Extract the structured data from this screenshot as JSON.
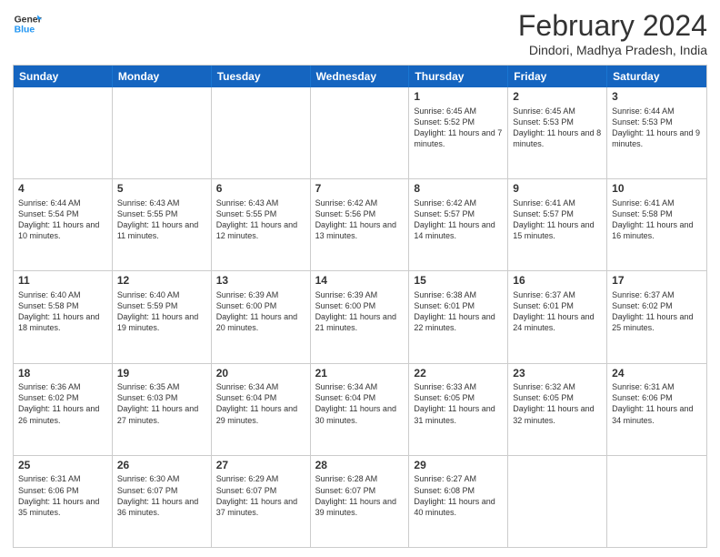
{
  "logo": {
    "line1": "General",
    "line2": "Blue"
  },
  "title": "February 2024",
  "subtitle": "Dindori, Madhya Pradesh, India",
  "days": [
    "Sunday",
    "Monday",
    "Tuesday",
    "Wednesday",
    "Thursday",
    "Friday",
    "Saturday"
  ],
  "weeks": [
    [
      {
        "day": "",
        "info": ""
      },
      {
        "day": "",
        "info": ""
      },
      {
        "day": "",
        "info": ""
      },
      {
        "day": "",
        "info": ""
      },
      {
        "day": "1",
        "info": "Sunrise: 6:45 AM\nSunset: 5:52 PM\nDaylight: 11 hours and 7 minutes."
      },
      {
        "day": "2",
        "info": "Sunrise: 6:45 AM\nSunset: 5:53 PM\nDaylight: 11 hours and 8 minutes."
      },
      {
        "day": "3",
        "info": "Sunrise: 6:44 AM\nSunset: 5:53 PM\nDaylight: 11 hours and 9 minutes."
      }
    ],
    [
      {
        "day": "4",
        "info": "Sunrise: 6:44 AM\nSunset: 5:54 PM\nDaylight: 11 hours and 10 minutes."
      },
      {
        "day": "5",
        "info": "Sunrise: 6:43 AM\nSunset: 5:55 PM\nDaylight: 11 hours and 11 minutes."
      },
      {
        "day": "6",
        "info": "Sunrise: 6:43 AM\nSunset: 5:55 PM\nDaylight: 11 hours and 12 minutes."
      },
      {
        "day": "7",
        "info": "Sunrise: 6:42 AM\nSunset: 5:56 PM\nDaylight: 11 hours and 13 minutes."
      },
      {
        "day": "8",
        "info": "Sunrise: 6:42 AM\nSunset: 5:57 PM\nDaylight: 11 hours and 14 minutes."
      },
      {
        "day": "9",
        "info": "Sunrise: 6:41 AM\nSunset: 5:57 PM\nDaylight: 11 hours and 15 minutes."
      },
      {
        "day": "10",
        "info": "Sunrise: 6:41 AM\nSunset: 5:58 PM\nDaylight: 11 hours and 16 minutes."
      }
    ],
    [
      {
        "day": "11",
        "info": "Sunrise: 6:40 AM\nSunset: 5:58 PM\nDaylight: 11 hours and 18 minutes."
      },
      {
        "day": "12",
        "info": "Sunrise: 6:40 AM\nSunset: 5:59 PM\nDaylight: 11 hours and 19 minutes."
      },
      {
        "day": "13",
        "info": "Sunrise: 6:39 AM\nSunset: 6:00 PM\nDaylight: 11 hours and 20 minutes."
      },
      {
        "day": "14",
        "info": "Sunrise: 6:39 AM\nSunset: 6:00 PM\nDaylight: 11 hours and 21 minutes."
      },
      {
        "day": "15",
        "info": "Sunrise: 6:38 AM\nSunset: 6:01 PM\nDaylight: 11 hours and 22 minutes."
      },
      {
        "day": "16",
        "info": "Sunrise: 6:37 AM\nSunset: 6:01 PM\nDaylight: 11 hours and 24 minutes."
      },
      {
        "day": "17",
        "info": "Sunrise: 6:37 AM\nSunset: 6:02 PM\nDaylight: 11 hours and 25 minutes."
      }
    ],
    [
      {
        "day": "18",
        "info": "Sunrise: 6:36 AM\nSunset: 6:02 PM\nDaylight: 11 hours and 26 minutes."
      },
      {
        "day": "19",
        "info": "Sunrise: 6:35 AM\nSunset: 6:03 PM\nDaylight: 11 hours and 27 minutes."
      },
      {
        "day": "20",
        "info": "Sunrise: 6:34 AM\nSunset: 6:04 PM\nDaylight: 11 hours and 29 minutes."
      },
      {
        "day": "21",
        "info": "Sunrise: 6:34 AM\nSunset: 6:04 PM\nDaylight: 11 hours and 30 minutes."
      },
      {
        "day": "22",
        "info": "Sunrise: 6:33 AM\nSunset: 6:05 PM\nDaylight: 11 hours and 31 minutes."
      },
      {
        "day": "23",
        "info": "Sunrise: 6:32 AM\nSunset: 6:05 PM\nDaylight: 11 hours and 32 minutes."
      },
      {
        "day": "24",
        "info": "Sunrise: 6:31 AM\nSunset: 6:06 PM\nDaylight: 11 hours and 34 minutes."
      }
    ],
    [
      {
        "day": "25",
        "info": "Sunrise: 6:31 AM\nSunset: 6:06 PM\nDaylight: 11 hours and 35 minutes."
      },
      {
        "day": "26",
        "info": "Sunrise: 6:30 AM\nSunset: 6:07 PM\nDaylight: 11 hours and 36 minutes."
      },
      {
        "day": "27",
        "info": "Sunrise: 6:29 AM\nSunset: 6:07 PM\nDaylight: 11 hours and 37 minutes."
      },
      {
        "day": "28",
        "info": "Sunrise: 6:28 AM\nSunset: 6:07 PM\nDaylight: 11 hours and 39 minutes."
      },
      {
        "day": "29",
        "info": "Sunrise: 6:27 AM\nSunset: 6:08 PM\nDaylight: 11 hours and 40 minutes."
      },
      {
        "day": "",
        "info": ""
      },
      {
        "day": "",
        "info": ""
      }
    ]
  ]
}
